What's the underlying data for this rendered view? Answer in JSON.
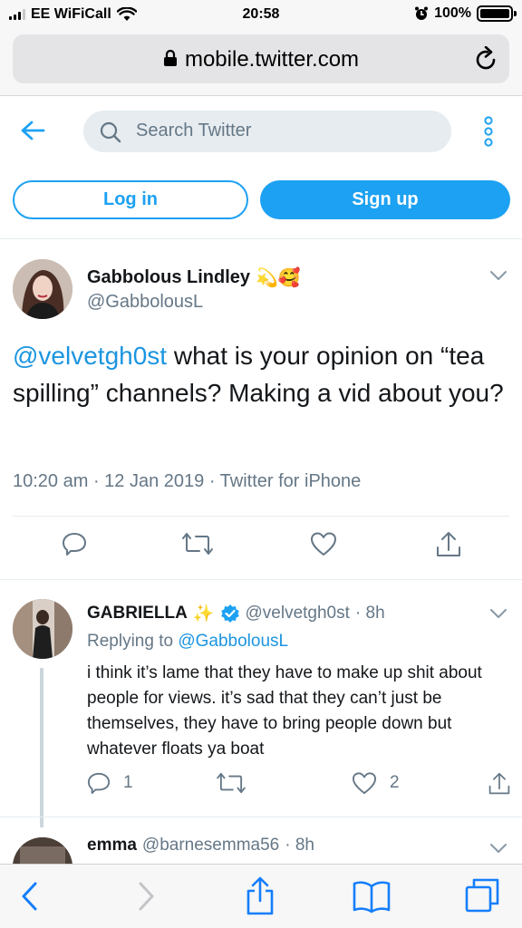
{
  "status_bar": {
    "carrier": "EE WiFiCall",
    "time": "20:58",
    "battery": "100%"
  },
  "browser": {
    "url": "mobile.twitter.com"
  },
  "header": {
    "search_placeholder": "Search Twitter",
    "login_label": "Log in",
    "signup_label": "Sign up"
  },
  "main_tweet": {
    "name": "Gabbolous Lindley",
    "name_emoji": "💫🥰",
    "handle": "@GabbolousL",
    "mention": "@velvetgh0st",
    "text": " what is your opinion on “tea spilling” channels? Making a vid about you?",
    "meta": "10:20 am · 12 Jan 2019 · Twitter for iPhone"
  },
  "reply": {
    "name": "GABRIELLA",
    "name_emoji": "✨",
    "handle": "@velvetgh0st",
    "age": "· 8h",
    "replying_prefix": "Replying to",
    "replying_to": "@GabbolousL",
    "text": "i think it’s lame that they have to make up shit about people for views. it’s sad that they can’t just be themselves, they have to bring people down but whatever floats ya boat",
    "reply_count": "1",
    "like_count": "2"
  },
  "next_tweet": {
    "name": "emma",
    "handle": "@barnesemma56",
    "age": "· 8h"
  },
  "colors": {
    "twitter_blue": "#1da1f2",
    "mention_blue": "#1b95e0",
    "muted": "#657786",
    "ios_blue": "#157efb"
  },
  "icons": [
    "back-arrow-icon",
    "search-icon",
    "more-icon",
    "chevron-down-icon",
    "reply-icon",
    "retweet-icon",
    "like-icon",
    "share-icon",
    "verified-icon",
    "lock-icon",
    "reload-icon",
    "safari-back-icon",
    "safari-forward-icon",
    "safari-share-icon",
    "bookmarks-icon",
    "tabs-icon"
  ]
}
